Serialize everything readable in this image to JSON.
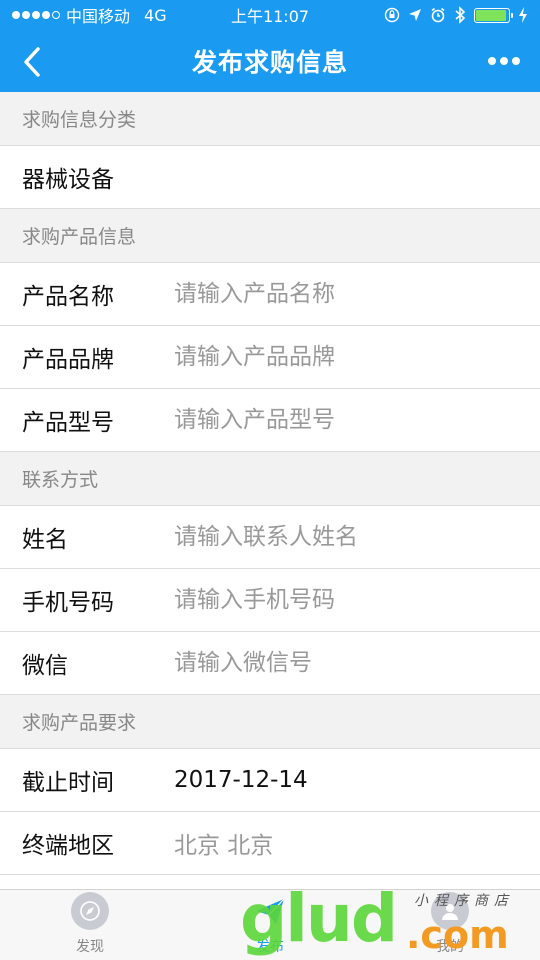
{
  "status_bar": {
    "carrier": "中国移动",
    "network": "4G",
    "time": "上午11:07",
    "battery_level": 0.95,
    "signal_bars": 4,
    "signal_total": 5
  },
  "nav": {
    "title": "发布求购信息"
  },
  "sections": {
    "category": {
      "header": "求购信息分类",
      "value": "器械设备"
    },
    "product": {
      "header": "求购产品信息",
      "name_label": "产品名称",
      "name_placeholder": "请输入产品名称",
      "brand_label": "产品品牌",
      "brand_placeholder": "请输入产品品牌",
      "model_label": "产品型号",
      "model_placeholder": "请输入产品型号"
    },
    "contact": {
      "header": "联系方式",
      "name_label": "姓名",
      "name_placeholder": "请输入联系人姓名",
      "phone_label": "手机号码",
      "phone_placeholder": "请输入手机号码",
      "wechat_label": "微信",
      "wechat_placeholder": "请输入微信号"
    },
    "requirements": {
      "header": "求购产品要求",
      "deadline_label": "截止时间",
      "deadline_value": "2017-12-14",
      "region_label": "终端地区",
      "region_value": "北京 北京"
    }
  },
  "tabbar": {
    "tabs": [
      {
        "label": "发现",
        "icon": "compass-icon"
      },
      {
        "label": "发布",
        "icon": "send-icon"
      },
      {
        "label": "我的",
        "icon": "user-icon"
      }
    ],
    "active_index": 1
  },
  "watermark": {
    "brand": "glud",
    "suffix": ".com",
    "tagline": "小程序商店"
  },
  "colors": {
    "accent": "#1a9af0",
    "background": "#f2f2f2",
    "placeholder": "#999999"
  }
}
